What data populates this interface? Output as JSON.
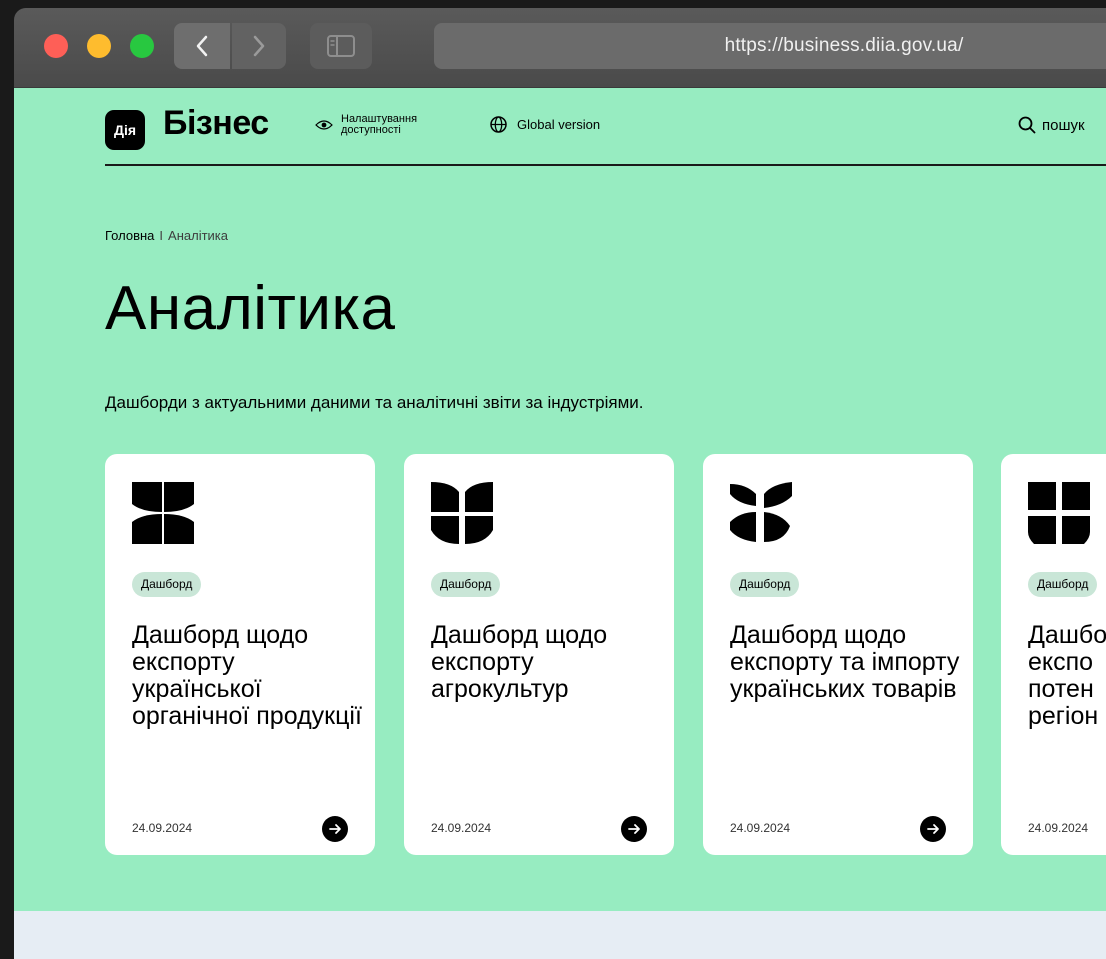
{
  "browser": {
    "url": "https://business.diia.gov.ua/"
  },
  "header": {
    "logo_text": "Дія",
    "brand": "Бізнес",
    "accessibility_label": "Налаштування доступності",
    "global_label": "Global version",
    "search_label": "пошук"
  },
  "breadcrumb": {
    "home": "Головна",
    "separator": "I",
    "current": "Аналітика"
  },
  "page": {
    "title": "Аналітика",
    "subtitle": "Дашборди з актуальними даними та аналітичні звіти за індустріями."
  },
  "cards": [
    {
      "tag": "Дашборд",
      "title": "Дашборд щодо експорту української органічної продукції",
      "date": "24.09.2024",
      "icon": "clover-icon"
    },
    {
      "tag": "Дашборд",
      "title": "Дашборд щодо експорту агрокультур",
      "date": "24.09.2024",
      "icon": "leaves-icon"
    },
    {
      "tag": "Дашборд",
      "title": "Дашборд щодо експорту та імпорту українських товарів",
      "date": "24.09.2024",
      "icon": "sprout-icon"
    },
    {
      "tag": "Дашборд",
      "title": "Дашбо експо потен регіон",
      "date": "24.09.2024",
      "icon": "blocks-icon"
    }
  ],
  "colors": {
    "page_bg": "#97ecc1",
    "card_bg": "#ffffff",
    "tag_bg": "#c9e6d7",
    "footer_bg": "#e6edf4"
  }
}
